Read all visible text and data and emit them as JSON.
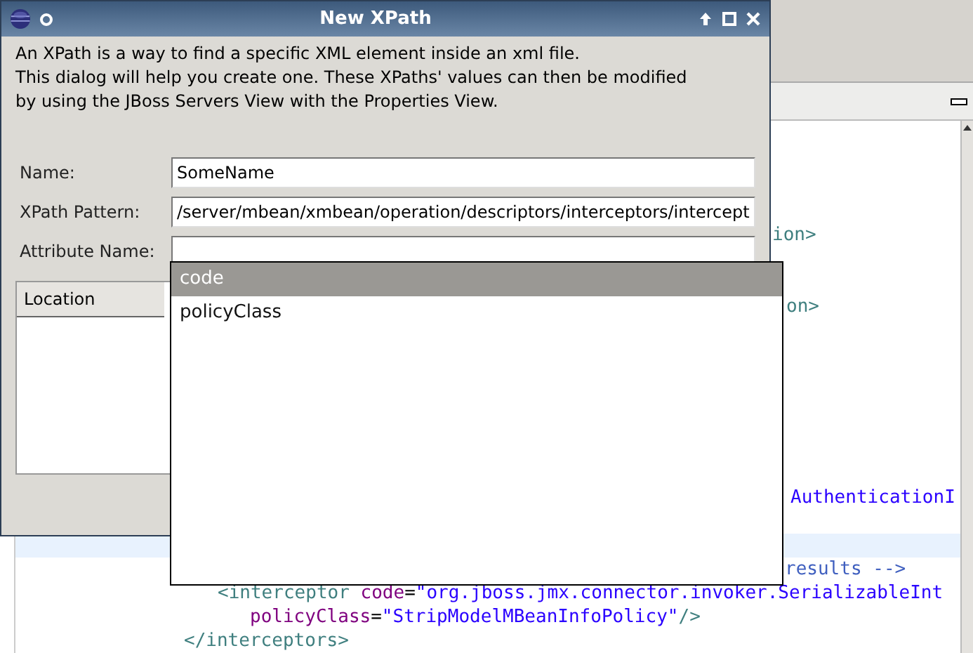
{
  "window": {
    "title": "New XPath"
  },
  "description": "An XPath is a way to find a specific XML element inside an xml file.\nThis dialog will help you create one. These XPaths' values can then be modified\nby using the JBoss Servers View with the Properties View.",
  "fields": [
    {
      "label": "Name:",
      "value": "SomeName"
    },
    {
      "label": "XPath Pattern:",
      "value": "/server/mbean/xmbean/operation/descriptors/interceptors/intercept"
    },
    {
      "label": "Attribute Name:"
    }
  ],
  "table": {
    "columns": [
      "Location"
    ]
  },
  "autocomplete": {
    "items": [
      {
        "label": "code",
        "selected": true
      },
      {
        "label": "policyClass",
        "selected": false
      }
    ]
  },
  "editor": {
    "lines": [
      {
        "highlighted": false,
        "segments": [
          {
            "kind": "tag",
            "text": "ion>"
          }
        ]
      },
      {
        "highlighted": false,
        "segments": [
          {
            "kind": "tag",
            "text": "on>"
          }
        ]
      },
      {
        "highlighted": false,
        "segments": [
          {
            "kind": "value",
            "text": "AuthenticationI"
          }
        ]
      },
      {
        "highlighted": true
      },
      {
        "highlighted": false,
        "segments": [
          {
            "kind": "comment",
            "text": "results -->"
          }
        ]
      },
      {
        "highlighted": false,
        "segments": [
          {
            "kind": "tag",
            "text": "<interceptor "
          },
          {
            "kind": "attr",
            "text": "code"
          },
          {
            "kind": "plain",
            "text": "="
          },
          {
            "kind": "value",
            "text": "\"org.jboss.jmx.connector.invoker.SerializableInt"
          }
        ]
      },
      {
        "highlighted": false,
        "segments": [
          {
            "kind": "attr",
            "text": "policyClass"
          },
          {
            "kind": "plain",
            "text": "="
          },
          {
            "kind": "value",
            "text": "\"StripModelMBeanInfoPolicy\""
          },
          {
            "kind": "tag",
            "text": "/>"
          }
        ]
      },
      {
        "highlighted": false,
        "segments": [
          {
            "kind": "tag",
            "text": "</interceptors>"
          }
        ]
      }
    ]
  }
}
